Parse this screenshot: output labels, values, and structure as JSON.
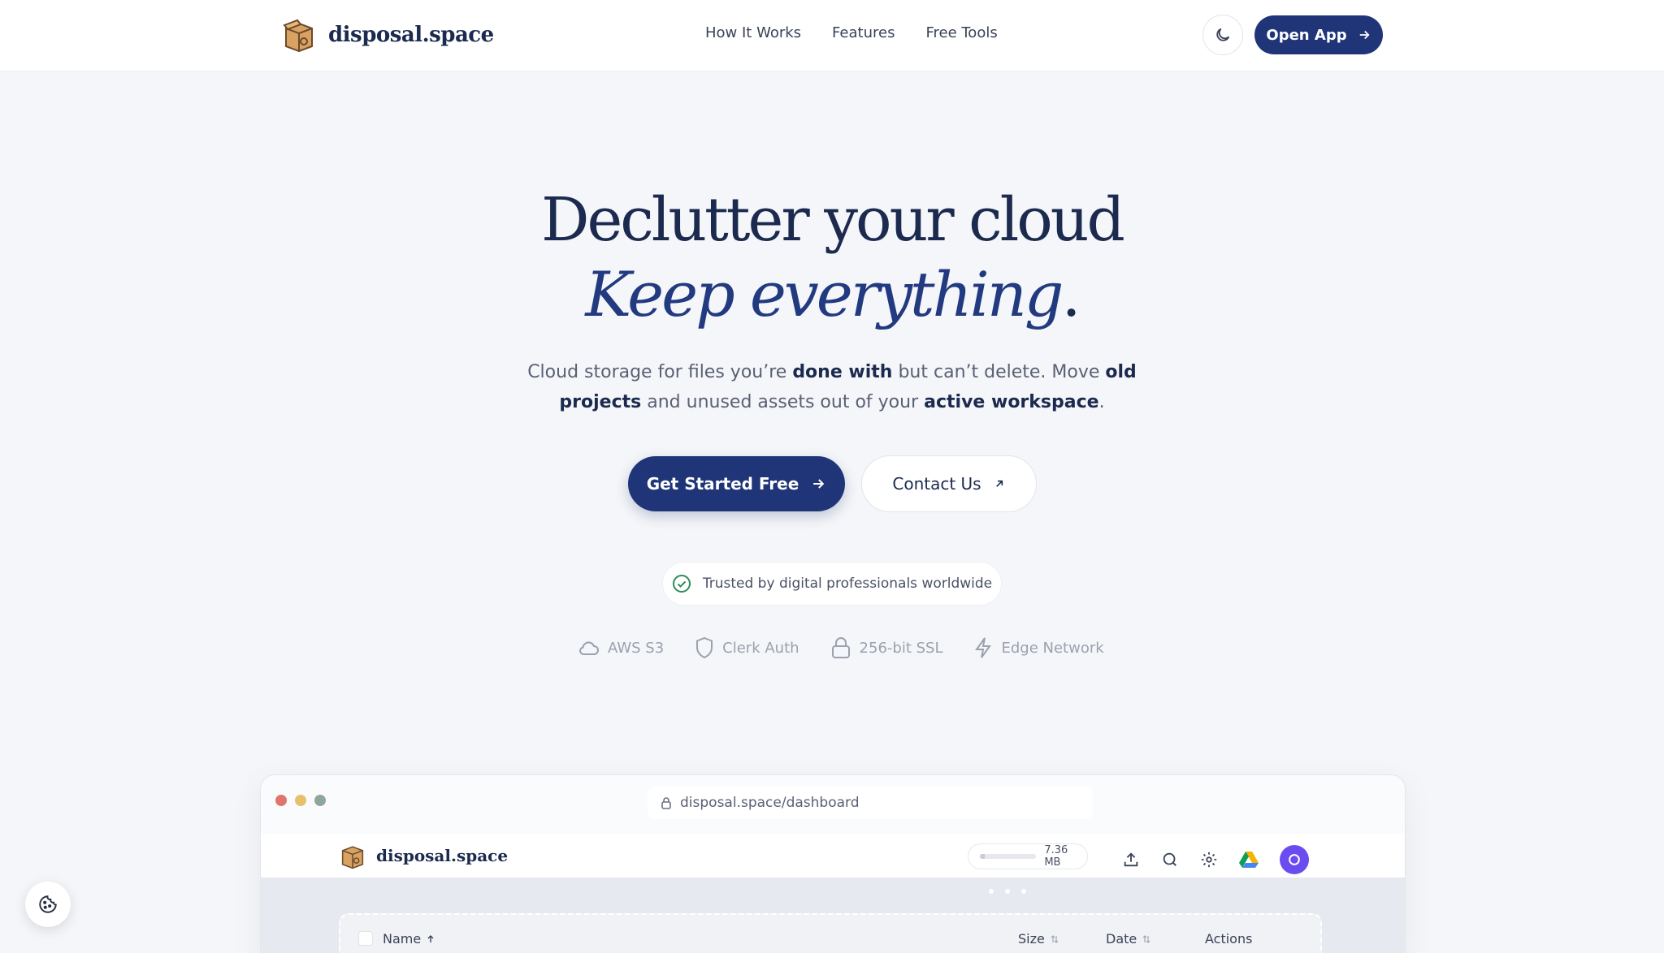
{
  "brand": {
    "name": "disposal.space"
  },
  "nav": {
    "items": [
      "How It Works",
      "Features",
      "Free Tools"
    ]
  },
  "header": {
    "open_app": "Open App"
  },
  "hero": {
    "title_line1": "Declutter your cloud",
    "title_line2": "Keep everything",
    "title_period": ".",
    "subtitle": {
      "p1": "Cloud storage for files you’re ",
      "b1": "done with",
      "p2": " but can’t delete. Move ",
      "b2": "old projects",
      "p3": " and unused assets out of your ",
      "b3": "active workspace",
      "p4": "."
    },
    "cta_primary": "Get Started Free",
    "cta_secondary": "Contact Us",
    "trust": "Trusted by digital professionals worldwide",
    "badges": [
      "AWS S3",
      "Clerk Auth",
      "256-bit SSL",
      "Edge Network"
    ]
  },
  "mockup": {
    "url": "disposal.space/dashboard",
    "brand": "disposal.space",
    "storage_used": "7.36 MB",
    "storage_fraction": 0.08,
    "columns": {
      "name": "Name",
      "size": "Size",
      "date": "Date",
      "actions": "Actions"
    }
  },
  "colors": {
    "accent": "#1f3577",
    "dot_red": "#e0766b",
    "dot_yellow": "#e8c06b",
    "dot_green": "#8fa79b"
  }
}
